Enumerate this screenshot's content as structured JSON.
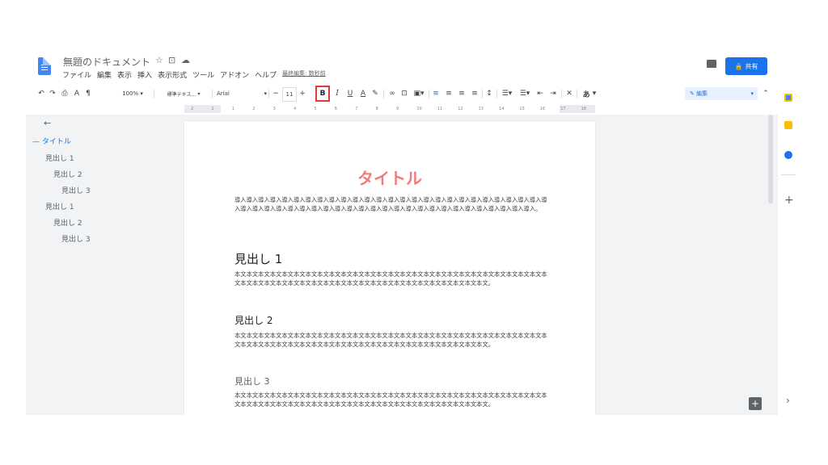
{
  "header": {
    "doc_title": "無題のドキュメント",
    "star_icon": "☆",
    "folder_icon": "⊡",
    "cloud_icon": "☁",
    "share_label": "共有",
    "last_edit": "最終編集: 数秒前"
  },
  "menu": [
    "ファイル",
    "編集",
    "表示",
    "挿入",
    "表示形式",
    "ツール",
    "アドオン",
    "ヘルプ"
  ],
  "toolbar": {
    "zoom": "100%",
    "style": "標準テキス…",
    "font": "Arial",
    "font_size": "11",
    "bold": "B",
    "italic": "I",
    "underline": "U",
    "text_color": "A",
    "input_mode": "あ",
    "edit_mode": "編集"
  },
  "ruler": [
    "2",
    "1",
    "1",
    "2",
    "3",
    "4",
    "5",
    "6",
    "7",
    "8",
    "9",
    "10",
    "11",
    "12",
    "13",
    "14",
    "15",
    "16",
    "17",
    "18"
  ],
  "outline": {
    "back_arrow": "←",
    "items": [
      {
        "label": "タイトル",
        "level": 0
      },
      {
        "label": "見出し 1",
        "level": 1
      },
      {
        "label": "見出し 2",
        "level": 2
      },
      {
        "label": "見出し 3",
        "level": 3
      },
      {
        "label": "見出し 1",
        "level": 1
      },
      {
        "label": "見出し 2",
        "level": 2
      },
      {
        "label": "見出し 3",
        "level": 3
      }
    ]
  },
  "document": {
    "title": "タイトル",
    "intro": "導入導入導入導入導入導入導入導入導入導入導入導入導入導入導入導入導入導入導入導入導入導入導入導入導入導入導入導入導入導入導入導入導入導入導入導入導入導入導入導入導入導入導入導入導入導入導入導入導入導入導入導入。",
    "h1": "見出し 1",
    "h1_body": "本文本文本文本文本文本文本文本文本文本文本文本文本文本文本文本文本文本文本文本文本文本文本文本文本文本文本文本文本文本文本文本文本文本文本文本文本文本文本文本文本文本文本文本文本文本文本文本文。",
    "h2": "見出し 2",
    "h2_body": "本文本文本文本文本文本文本文本文本文本文本文本文本文本文本文本文本文本文本文本文本文本文本文本文本文本文本文本文本文本文本文本文本文本文本文本文本文本文本文本文本文本文本文本文本文本文本文本文。",
    "h3": "見出し 3",
    "h3_body": "本文本文本文本文本文本文本文本文本文本文本文本文本文本文本文本文本文本文本文本文本文本文本文本文本文本文本文本文本文本文本文本文本文本文本文本文本文本文本文本文本文本文本文本文本文本文本文本文。"
  },
  "side_panel": {
    "add_icon": "+",
    "collapse_icon": "›"
  },
  "colors": {
    "accent": "#1a73e8",
    "title_pink": "#ef7b7b",
    "highlight_box": "#e53935"
  }
}
